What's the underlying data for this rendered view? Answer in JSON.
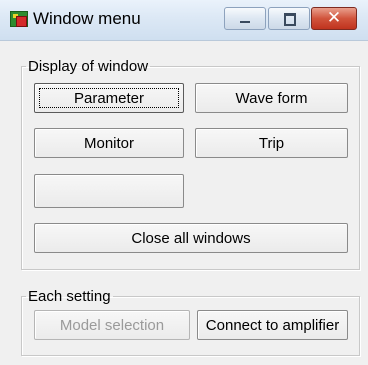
{
  "window": {
    "title": "Window menu",
    "icon": "app-icon",
    "caption_buttons": {
      "minimize_icon": "minimize-icon",
      "maximize_icon": "maximize-icon",
      "close_icon": "close-icon",
      "close_glyph": "✕",
      "close_color": "#c0331e"
    }
  },
  "display_group": {
    "legend": "Display of window",
    "buttons": {
      "parameter": "Parameter",
      "wave_form": "Wave form",
      "monitor": "Monitor",
      "trip": "Trip",
      "blank": "",
      "close_all": "Close all windows"
    },
    "focused_button": "Parameter"
  },
  "setting_group": {
    "legend": "Each setting",
    "buttons": {
      "model_selection": "Model selection",
      "connect_amplifier": "Connect to amplifier"
    },
    "disabled_button": "Model selection"
  }
}
